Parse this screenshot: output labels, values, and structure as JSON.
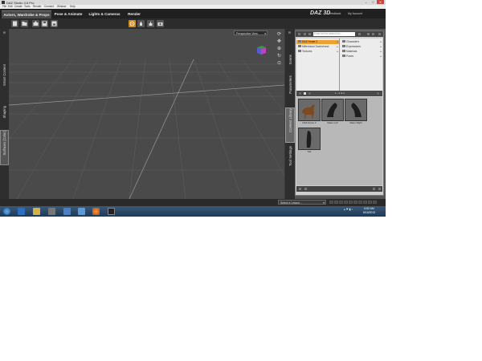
{
  "window": {
    "title": "DAZ Studio 4.6 Pro",
    "controls": [
      "–",
      "□",
      "✕"
    ]
  },
  "menu": [
    "File",
    "Edit",
    "Create",
    "Tools",
    "Render",
    "Connect",
    "Window",
    "Help"
  ],
  "tabs": [
    "Actors, Wardrobe & Props",
    "Pose & Animate",
    "Lights & Cameras",
    "Render"
  ],
  "header": {
    "brand": "DAZ 3D",
    "feedback": "Feedback",
    "account": "My Account"
  },
  "left_panel_tabs": [
    "Smart Content",
    "Shaping",
    "Surfaces (Color)"
  ],
  "viewport": {
    "camera": "Perspective View"
  },
  "right_panel_tabs": [
    "Scene",
    "Parameters",
    "Content Library",
    "Tool Settings"
  ],
  "content_library": {
    "search_placeholder": "Enter text to search for...",
    "folders_left": [
      {
        "label": "DAZ Horse 2",
        "selected": true
      },
      {
        "label": "Millennium Dachshund",
        "selected": false
      },
      {
        "label": "Textures",
        "selected": false
      }
    ],
    "folders_right": [
      {
        "label": "Characters",
        "selected": false
      },
      {
        "label": "Expressions",
        "selected": false
      },
      {
        "label": "Materials",
        "selected": false
      },
      {
        "label": "Poses",
        "selected": false
      }
    ],
    "page_indicator": "1 - 4 of 4",
    "items": [
      {
        "label": "DAZ Horse 2"
      },
      {
        "label": "Mane Left"
      },
      {
        "label": "Mane Right"
      },
      {
        "label": "Tail"
      }
    ]
  },
  "statusbar": {
    "lesson_placeholder": "Select a Lesson..."
  },
  "clock": {
    "time": "6:52 AM",
    "date": "8/16/2013"
  },
  "colors": {
    "accent": "#f0a030",
    "panel_bg": "#3a3a3a",
    "viewport_bg": "#4a4a4a"
  }
}
